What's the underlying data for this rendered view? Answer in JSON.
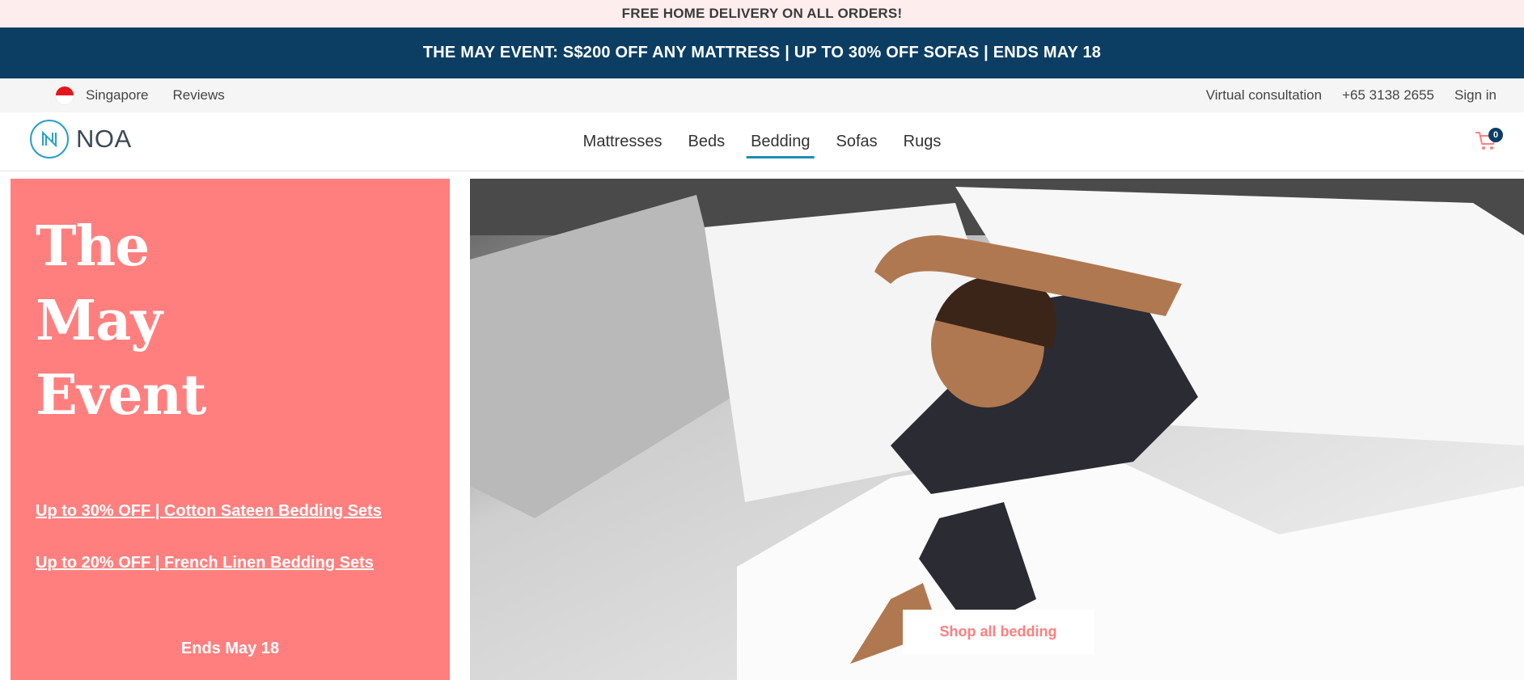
{
  "promo": {
    "top": "FREE HOME DELIVERY ON ALL ORDERS!",
    "main": "THE MAY EVENT: S$200 OFF ANY MATTRESS | UP TO 30% OFF SOFAS | ENDS MAY 18"
  },
  "utility": {
    "region": "Singapore",
    "reviews": "Reviews",
    "consultation": "Virtual consultation",
    "phone": "+65 3138 2655",
    "signin": "Sign in"
  },
  "header": {
    "logo_text": "NOA",
    "nav": [
      "Mattresses",
      "Beds",
      "Bedding",
      "Sofas",
      "Rugs"
    ],
    "active_nav": "Bedding",
    "cart_count": "0"
  },
  "hero": {
    "headline_lines": [
      "The",
      "May",
      "Event"
    ],
    "links": [
      "Up to 30% OFF | Cotton Sateen Bedding Sets",
      "Up to 20% OFF | French Linen Bedding Sets"
    ],
    "ends": "Ends May 18",
    "cta": "Shop all bedding"
  },
  "colors": {
    "promo_top_bg": "#fdeeed",
    "promo_main_bg": "#0c3e64",
    "panel_bg": "#ff7f7f",
    "accent": "#1b8fb3"
  }
}
